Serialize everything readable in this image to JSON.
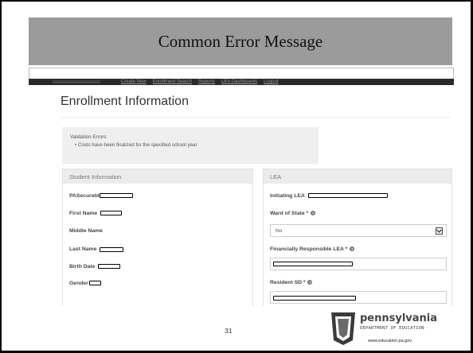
{
  "slide": {
    "title": "Common Error Message",
    "page_number": "31"
  },
  "nav": {
    "links": [
      "Create New",
      "Enrollment Search",
      "Reports",
      "LEA Dashboards",
      "Logout"
    ]
  },
  "page": {
    "heading": "Enrollment Information"
  },
  "validation": {
    "title": "Validation Errors:",
    "items": [
      "Costs have been finalized for the specified school year"
    ]
  },
  "student_panel": {
    "title": "Student Information",
    "fields": {
      "pasecureid": "PASecureId",
      "first_name": "First Name",
      "middle_name": "Middle Name",
      "last_name": "Last Name",
      "birth_date": "Birth Date",
      "gender": "Gender"
    }
  },
  "lea_panel": {
    "title": "LEA",
    "initiating_lea": "Initiating LEA",
    "ward_of_state": "Ward of State *",
    "ward_of_state_value": "No",
    "financially_responsible_lea": "Financially Responsible LEA *",
    "resident_sd": "Resident SD *"
  },
  "branding": {
    "name": "pennsylvania",
    "department": "DEPARTMENT OF EDUCATION",
    "url": "www.education.pa.gov"
  },
  "icons": {
    "help": "question-circle-icon",
    "dropdown": "chevron-down-icon",
    "logo": "keystone-icon"
  }
}
